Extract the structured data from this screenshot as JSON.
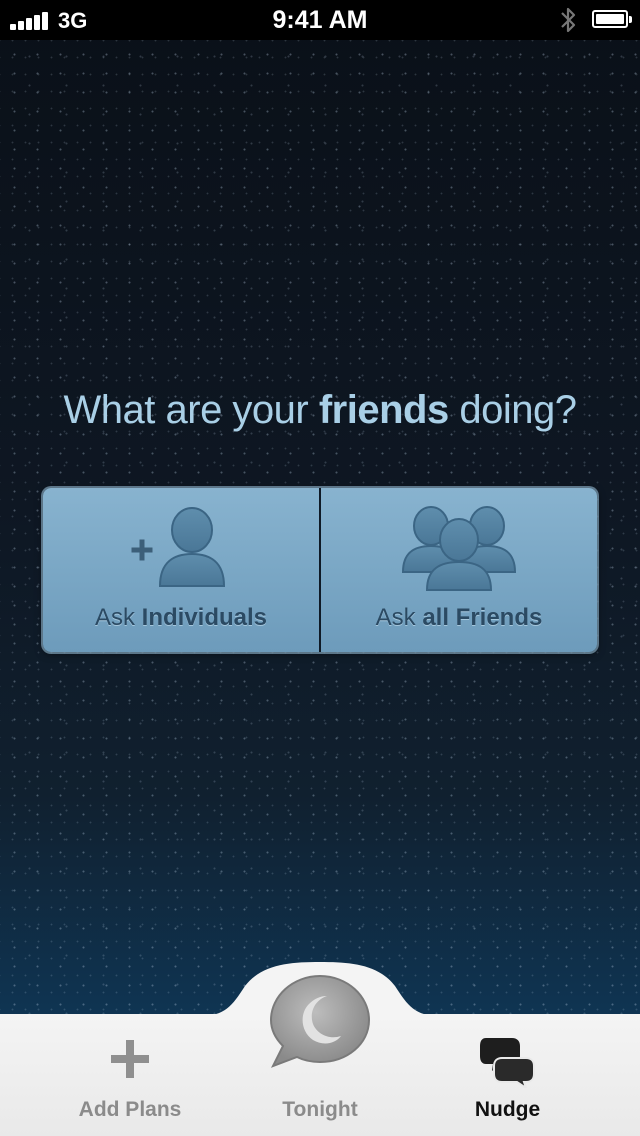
{
  "status_bar": {
    "carrier": "3G",
    "time": "9:41 AM",
    "icons": [
      "signal-bars-icon",
      "bluetooth-icon",
      "battery-icon"
    ]
  },
  "headline": {
    "prefix": "What are your ",
    "emphasis": "friends",
    "suffix": " doing?"
  },
  "ask_buttons": [
    {
      "prefix": "Ask ",
      "emphasis": "Individuals",
      "icon": "add-person-icon"
    },
    {
      "prefix": "Ask ",
      "emphasis": "all Friends",
      "icon": "group-icon"
    }
  ],
  "tab_bar": {
    "tabs": [
      {
        "label": "Add Plans",
        "icon": "plus-icon",
        "selected": false
      },
      {
        "label": "Tonight",
        "icon": "moon-speech-bubble-icon",
        "selected": false
      },
      {
        "label": "Nudge",
        "icon": "chat-bubbles-icon",
        "selected": true
      }
    ]
  },
  "colors": {
    "headline": "#a9cfe6",
    "button_fill": "#7aa7c5",
    "button_text": "#2b4a63",
    "tab_active": "#111111",
    "tab_inactive": "#8b8b8b"
  }
}
